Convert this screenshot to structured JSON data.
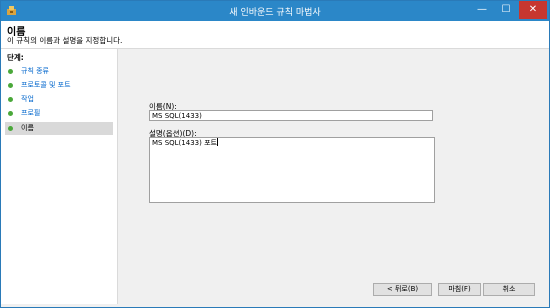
{
  "window": {
    "title": "새 인바운드 규칙 마법사",
    "controls": {
      "minimize": "—",
      "maximize": "☐",
      "close": "✕"
    }
  },
  "header": {
    "title": "이름",
    "description": "이 규칙의 이름과 설명을 지정합니다."
  },
  "steps": {
    "label": "단계:",
    "items": [
      {
        "label": "규칙 종류"
      },
      {
        "label": "프로토콜 및 포트"
      },
      {
        "label": "작업"
      },
      {
        "label": "프로필"
      },
      {
        "label": "이름"
      }
    ]
  },
  "form": {
    "name_label": "이름(N):",
    "name_value": "MS SQL(1433)",
    "description_label": "설명(옵션)(D):",
    "description_value": "MS SQL(1433) 포트"
  },
  "buttons": {
    "back": "< 뒤로(B)",
    "finish": "마침(F)",
    "cancel": "취소"
  },
  "colors": {
    "titlebar": "#2b87c8",
    "close_button": "#c7372f",
    "link": "#0066cc",
    "step_dot": "#4aa83a"
  }
}
